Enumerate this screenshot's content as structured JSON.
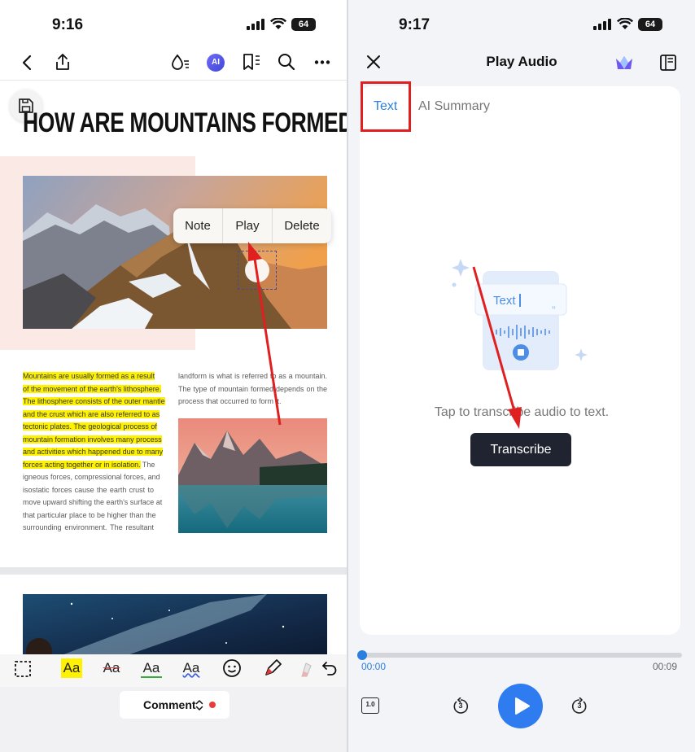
{
  "left": {
    "status": {
      "time": "9:16",
      "battery": "64"
    },
    "toolbar_icons": [
      "back-icon",
      "share-icon",
      "ink-drop-icon",
      "ai-icon",
      "bookmark-list-icon",
      "search-icon",
      "more-icon"
    ],
    "ai_badge": "AI",
    "doc_title": "HOW ARE MOUNTAINS FORMED?",
    "context_menu": {
      "note": "Note",
      "play": "Play",
      "delete": "Delete"
    },
    "col1_highlighted": [
      "Mountains are usually formed as a result",
      "of the movement of the earth's lithosphere.",
      "The lithosphere consists of the outer mantle",
      "and the crust which are also referred to as",
      "tectonic plates. The geological process of",
      "mountain formation involves many process",
      "and activities which happened due to many"
    ],
    "col1_mixed": {
      "highlighted": "forces acting together or in isolation.",
      "plain": " The"
    },
    "col1_plain": [
      "igneous forces, compressional forces, and",
      "isostatic forces cause the earth crust to",
      "move upward shifting the earth's surface at",
      "that particular place to be higher than the",
      "surrounding environment. The resultant"
    ],
    "col2": [
      "landform is what is referred to as a mountain.",
      "The type of mountain formed depends on the",
      "process that occurred to form it."
    ],
    "format_tools": {
      "highlight": "Aa",
      "strikethrough": "Aa",
      "underline": "Aa",
      "squiggly": "Aa"
    },
    "comment_label": "Comment",
    "colors": {
      "highlight": "#fff200",
      "annotation_red": "#e02020"
    }
  },
  "right": {
    "status": {
      "time": "9:17",
      "battery": "64"
    },
    "title": "Play Audio",
    "tabs": {
      "text": "Text",
      "ai_summary": "AI Summary"
    },
    "illustration_text": "Text",
    "hint": "Tap to transcribe audio to text.",
    "transcribe_label": "Transcribe",
    "progress": {
      "current": "00:00",
      "total": "00:09",
      "fraction": 0
    },
    "speed_label": "1.0",
    "skip_back_label": "3",
    "skip_forward_label": "3",
    "colors": {
      "accent": "#2b7fe0",
      "button_dark": "#1f2430",
      "play": "#2f7cf0"
    }
  }
}
